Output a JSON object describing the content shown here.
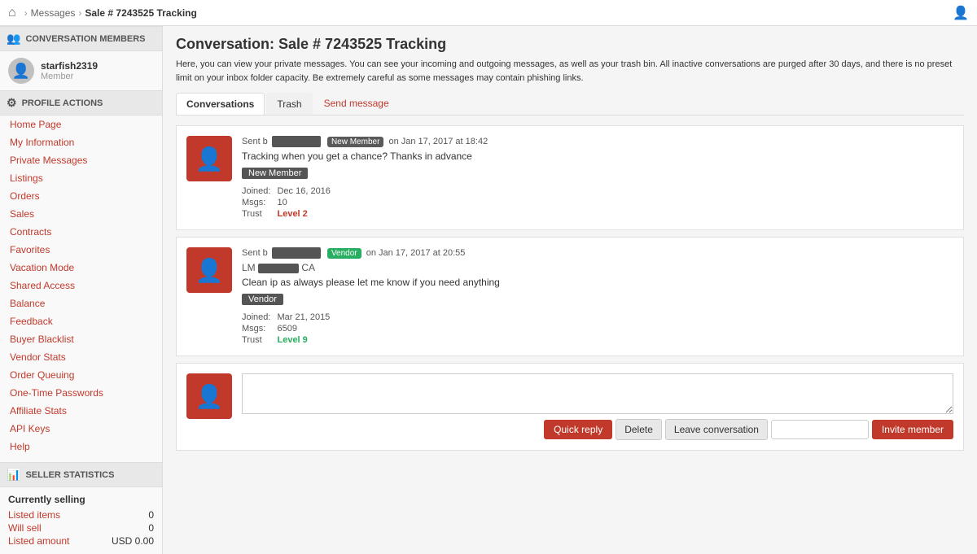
{
  "topnav": {
    "home_icon": "⌂",
    "breadcrumbs": [
      {
        "label": "Messages",
        "active": false
      },
      {
        "label": "Sale # 7243525 Tracking",
        "active": true
      }
    ],
    "account_icon": "👤"
  },
  "sidebar": {
    "conversation_members_label": "CONVERSATION MEMBERS",
    "user": {
      "name": "starfish2319",
      "role": "Member"
    },
    "profile_actions_label": "PROFILE ACTIONS",
    "nav_links": [
      "Home Page",
      "My Information",
      "Private Messages",
      "Listings",
      "Orders",
      "Sales",
      "Contracts",
      "Favorites",
      "Vacation Mode",
      "Shared Access",
      "Balance",
      "Feedback",
      "Buyer Blacklist",
      "Vendor Stats",
      "Order Queuing",
      "One-Time Passwords",
      "Affiliate Stats",
      "API Keys",
      "Help"
    ],
    "seller_stats_label": "SELLER STATISTICS",
    "currently_selling": "Currently selling",
    "stats": [
      {
        "key": "Listed items",
        "val": "0"
      },
      {
        "key": "Will sell",
        "val": "0"
      },
      {
        "key": "Listed amount",
        "val": "USD 0.00"
      }
    ]
  },
  "main": {
    "title": "Conversation: Sale # 7243525 Tracking",
    "description": "Here, you can view your private messages. You can see your incoming and outgoing messages, as well as your trash bin. All inactive conversations are purged after 30 days, and there is no preset limit on your inbox folder capacity. Be extremely careful as some messages may contain phishing links.",
    "tabs": [
      {
        "label": "Conversations",
        "active": true
      },
      {
        "label": "Trash",
        "active": false
      },
      {
        "label": "Send message",
        "active": false,
        "link": true
      }
    ],
    "messages": [
      {
        "sent_prefix": "Sent b",
        "sender_redacted": true,
        "sender_badge": "New Member",
        "date": "on Jan 17, 2017 at 18:42",
        "text": "Tracking when you get a chance? Thanks in advance",
        "username_label": "New Member",
        "joined": "Dec 16, 2016",
        "msgs": "10",
        "trust": "Level 2",
        "trust_color": "red"
      },
      {
        "sent_prefix": "Sent b",
        "sender_redacted": true,
        "sender_badge": "Vendor",
        "sender_badge_type": "vendor",
        "date": "on Jan 17, 2017 at 20:55",
        "location_prefix": "LM",
        "location_redacted": true,
        "location_suffix": "CA",
        "text": "Clean ip as always please let me know if you need anything",
        "username_label": "Vendor",
        "joined": "Mar 21, 2015",
        "msgs": "6509",
        "trust": "Level 9",
        "trust_color": "green"
      }
    ],
    "reply": {
      "placeholder": "",
      "buttons": {
        "quick_reply": "Quick reply",
        "delete": "Delete",
        "leave": "Leave conversation",
        "invite_placeholder": "",
        "invite": "Invite member"
      }
    }
  }
}
